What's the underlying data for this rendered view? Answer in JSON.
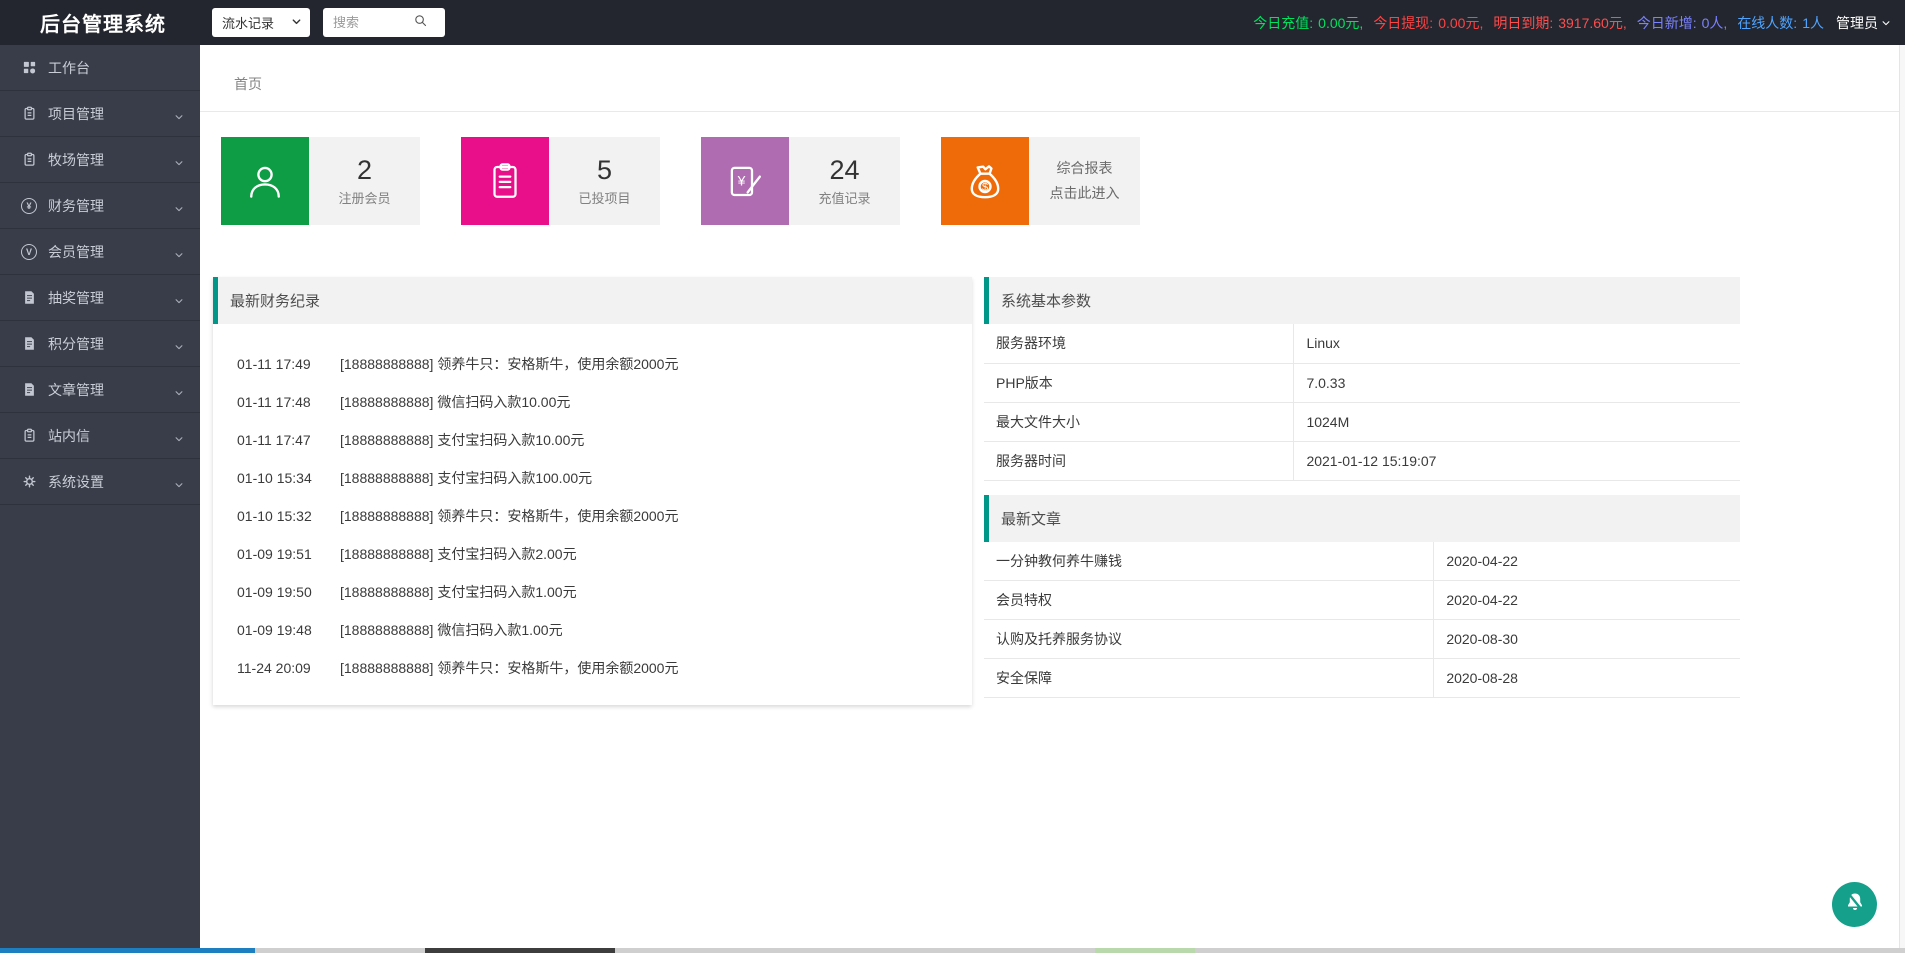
{
  "topbar": {
    "title": "后台管理系统",
    "select_value": "流水记录",
    "search_placeholder": "搜索",
    "stats": [
      {
        "label": "今日充值:",
        "value": "0.00元,",
        "color": "#00e15f"
      },
      {
        "label": "今日提现:",
        "value": "0.00元,",
        "color": "#ff4343"
      },
      {
        "label": "明日到期:",
        "value": "3917.60元,",
        "color": "#ff4d4d"
      },
      {
        "label": "今日新增:",
        "value": "0人,",
        "color": "#7a82ff"
      },
      {
        "label": "在线人数:",
        "value": "1人",
        "color": "#4fa4ff"
      }
    ],
    "admin_label": "管理员"
  },
  "sidebar": {
    "items": [
      {
        "label": "工作台",
        "icon": "dashboard-icon",
        "has_children": false
      },
      {
        "label": "项目管理",
        "icon": "clipboard-icon",
        "has_children": true
      },
      {
        "label": "牧场管理",
        "icon": "clipboard-icon",
        "has_children": true
      },
      {
        "label": "财务管理",
        "icon": "coin-yen-icon",
        "has_children": true
      },
      {
        "label": "会员管理",
        "icon": "coin-v-icon",
        "has_children": true
      },
      {
        "label": "抽奖管理",
        "icon": "doc-icon",
        "has_children": true
      },
      {
        "label": "积分管理",
        "icon": "doc-icon",
        "has_children": true
      },
      {
        "label": "文章管理",
        "icon": "doc-icon",
        "has_children": true
      },
      {
        "label": "站内信",
        "icon": "clipboard-icon",
        "has_children": true
      },
      {
        "label": "系统设置",
        "icon": "gear-icon",
        "has_children": true
      }
    ]
  },
  "breadcrumb": "首页",
  "cards": [
    {
      "value": "2",
      "label": "注册会员",
      "color": "#0e9d45",
      "icon": "user-icon"
    },
    {
      "value": "5",
      "label": "已投项目",
      "color": "#e90f8b",
      "icon": "clipboard-icon"
    },
    {
      "value": "24",
      "label": "充值记录",
      "color": "#af6cb0",
      "icon": "mobile-pay-icon"
    },
    {
      "line1": "综合报表",
      "line2": "点击此进入",
      "color": "#ef6b09",
      "icon": "money-bag-icon"
    }
  ],
  "finance": {
    "title": "最新财务纪录",
    "records": [
      {
        "time": "01-11 17:49",
        "text": "[18888888888] 领养牛只：安格斯牛，使用余额2000元"
      },
      {
        "time": "01-11 17:48",
        "text": "[18888888888] 微信扫码入款10.00元"
      },
      {
        "time": "01-11 17:47",
        "text": "[18888888888] 支付宝扫码入款10.00元"
      },
      {
        "time": "01-10 15:34",
        "text": "[18888888888] 支付宝扫码入款100.00元"
      },
      {
        "time": "01-10 15:32",
        "text": "[18888888888] 领养牛只：安格斯牛，使用余额2000元"
      },
      {
        "time": "01-09 19:51",
        "text": "[18888888888] 支付宝扫码入款2.00元"
      },
      {
        "time": "01-09 19:50",
        "text": "[18888888888] 支付宝扫码入款1.00元"
      },
      {
        "time": "01-09 19:48",
        "text": "[18888888888] 微信扫码入款1.00元"
      },
      {
        "time": "11-24 20:09",
        "text": "[18888888888] 领养牛只：安格斯牛，使用余额2000元"
      }
    ]
  },
  "params": {
    "title": "系统基本参数",
    "rows": [
      {
        "label": "服务器环境",
        "value": "Linux"
      },
      {
        "label": "PHP版本",
        "value": "7.0.33"
      },
      {
        "label": "最大文件大小",
        "value": "1024M"
      },
      {
        "label": "服务器时间",
        "value": "2021-01-12 15:19:07"
      }
    ]
  },
  "articles": {
    "title": "最新文章",
    "rows": [
      {
        "title": "一分钟教何养牛赚钱",
        "date": "2020-04-22"
      },
      {
        "title": "会员特权",
        "date": "2020-04-22"
      },
      {
        "title": "认购及托养服务协议",
        "date": "2020-08-30"
      },
      {
        "title": "安全保障",
        "date": "2020-08-28"
      }
    ]
  },
  "colors": {
    "accent": "#009688",
    "topbar_bg": "#23262e",
    "sidebar_bg": "#393d49",
    "fab_bg": "#14a08a"
  }
}
